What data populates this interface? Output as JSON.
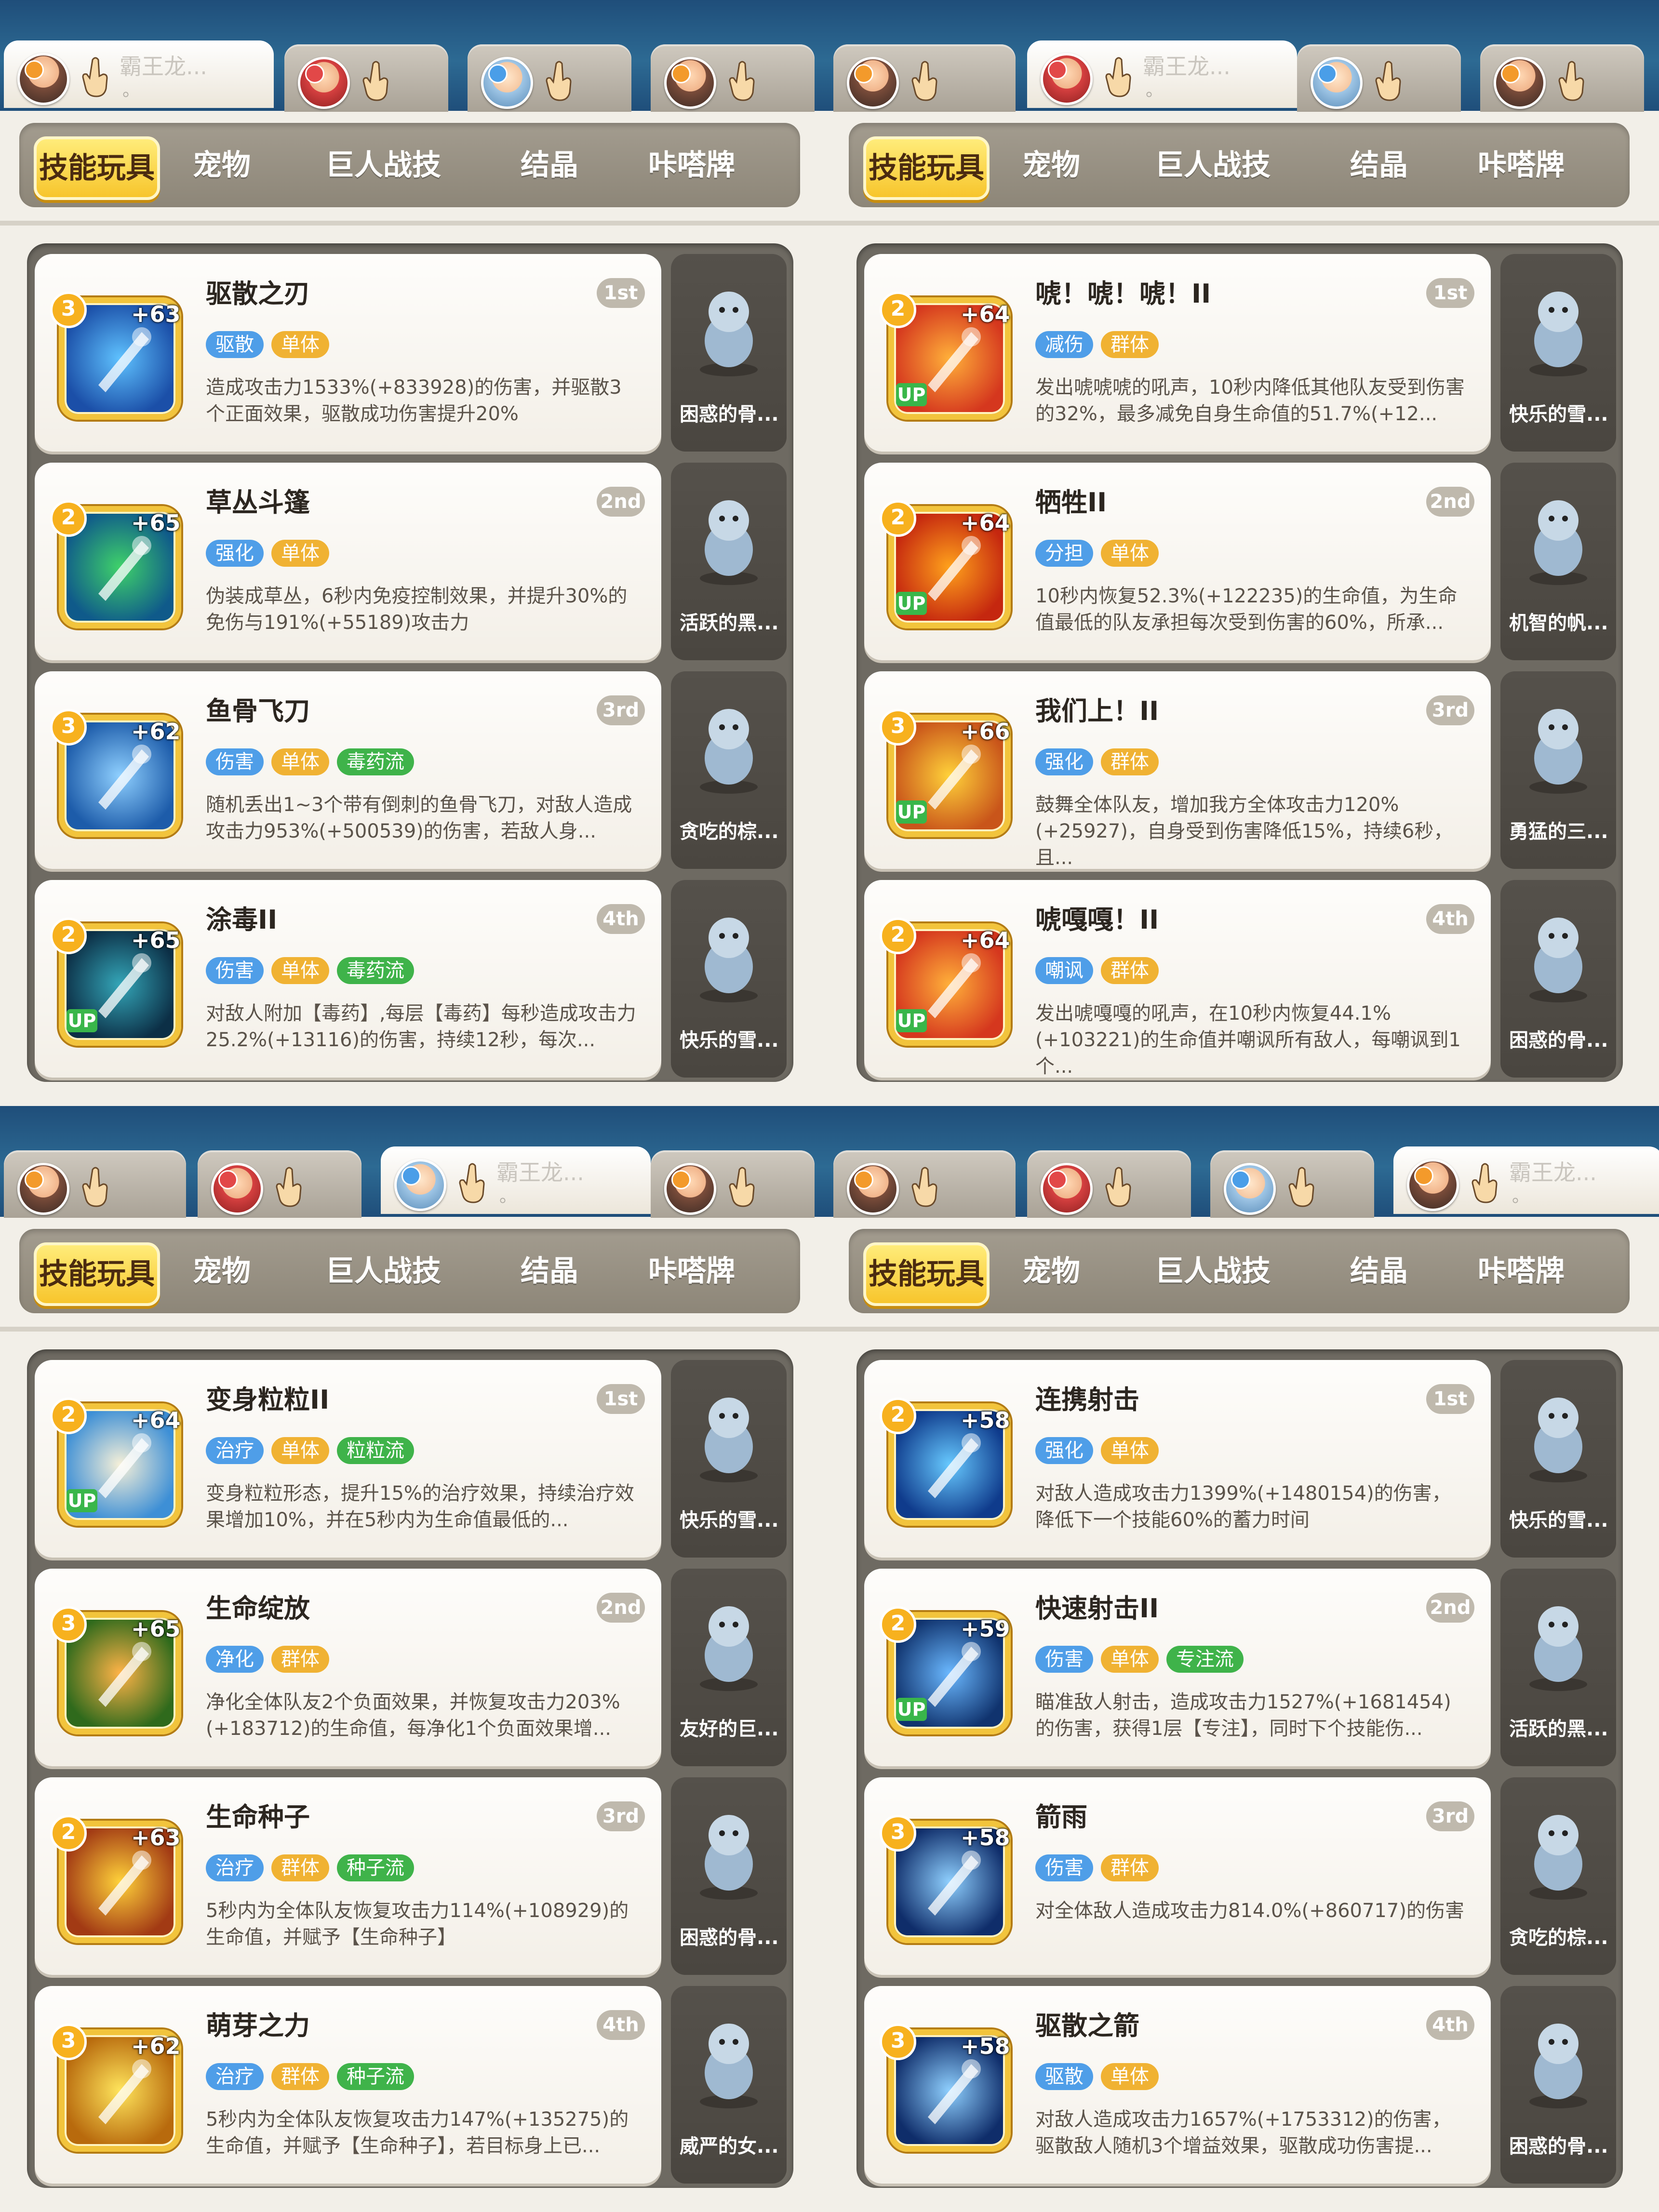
{
  "common": {
    "char_tab_name": "霸王龙...",
    "char_tab_dot": "。",
    "categories": [
      "技能玩具",
      "宠物",
      "巨人战技",
      "结晶",
      "咔嗒牌"
    ]
  },
  "panels": [
    {
      "active_tab": 0,
      "skills": [
        {
          "name": "驱散之刃",
          "rank": "1st",
          "tier": "3",
          "plus": "+63",
          "up": false,
          "tags": [
            "驱散",
            "单体"
          ],
          "desc": "造成攻击力1533%(+833928)的伤害，并驱散3个正面效果，驱散成功伤害提升20%",
          "pet": "困惑的骨...",
          "icon": "blade-icon"
        },
        {
          "name": "草丛斗篷",
          "rank": "2nd",
          "tier": "2",
          "plus": "+65",
          "up": false,
          "tags": [
            "强化",
            "单体"
          ],
          "desc": "伪装成草丛，6秒内免疫控制效果，并提升30%的免伤与191%(+55189)攻击力",
          "pet": "活跃的黑...",
          "icon": "bush-icon"
        },
        {
          "name": "鱼骨飞刀",
          "rank": "3rd",
          "tier": "3",
          "plus": "+62",
          "up": false,
          "tags": [
            "伤害",
            "单体",
            "毒药流"
          ],
          "desc": "随机丢出1~3个带有倒刺的鱼骨飞刀，对敌人造成攻击力953%(+500539)的伤害，若敌人身...",
          "pet": "贪吃的棕...",
          "icon": "fishbone-icon"
        },
        {
          "name": "涂毒II",
          "rank": "4th",
          "tier": "2",
          "plus": "+65",
          "up": true,
          "tags": [
            "伤害",
            "单体",
            "毒药流"
          ],
          "desc": "对敌人附加【毒药】,每层【毒药】每秒造成攻击力25.2%(+13116)的伤害，持续12秒，每次...",
          "pet": "快乐的雪...",
          "icon": "poison-drop-icon"
        }
      ]
    },
    {
      "active_tab": 1,
      "skills": [
        {
          "name": "唬！唬！唬！II",
          "rank": "1st",
          "tier": "2",
          "plus": "+64",
          "up": true,
          "tags": [
            "减伤",
            "群体"
          ],
          "desc": "发出唬唬唬的吼声，10秒内降低其他队友受到伤害的32%，最多减免自身生命值的51.7%(+12...",
          "pet": "快乐的雪...",
          "icon": "shout-icon"
        },
        {
          "name": "牺牲II",
          "rank": "2nd",
          "tier": "2",
          "plus": "+64",
          "up": true,
          "tags": [
            "分担",
            "单体"
          ],
          "desc": "10秒内恢复52.3%(+122235)的生命值，为生命值最低的队友承担每次受到伤害的60%，所承...",
          "pet": "机智的帆...",
          "icon": "sacrifice-icon"
        },
        {
          "name": "我们上！II",
          "rank": "3rd",
          "tier": "3",
          "plus": "+66",
          "up": true,
          "tags": [
            "强化",
            "群体"
          ],
          "desc": "鼓舞全体队友，增加我方全体攻击力120%(+25927)，自身受到伤害降低15%，持续6秒，且...",
          "pet": "勇猛的三...",
          "icon": "charge-icon"
        },
        {
          "name": "唬嘎嘎！II",
          "rank": "4th",
          "tier": "2",
          "plus": "+64",
          "up": true,
          "tags": [
            "嘲讽",
            "群体"
          ],
          "desc": "发出唬嘎嘎的吼声，在10秒内恢复44.1%(+103221)的生命值并嘲讽所有敌人，每嘲讽到1个...",
          "pet": "困惑的骨...",
          "icon": "taunt-icon"
        }
      ]
    },
    {
      "active_tab": 2,
      "skills": [
        {
          "name": "变身粒粒II",
          "rank": "1st",
          "tier": "2",
          "plus": "+64",
          "up": true,
          "tags": [
            "治疗",
            "单体",
            "粒粒流"
          ],
          "desc": "变身粒粒形态，提升15%的治疗效果，持续治疗效果增加10%，并在5秒内为生命值最低的...",
          "pet": "快乐的雪...",
          "icon": "owl-icon"
        },
        {
          "name": "生命绽放",
          "rank": "2nd",
          "tier": "3",
          "plus": "+65",
          "up": false,
          "tags": [
            "净化",
            "群体"
          ],
          "desc": "净化全体队友2个负面效果，并恢复攻击力203%(+183712)的生命值，每净化1个负面效果增...",
          "pet": "友好的巨...",
          "icon": "bloom-icon"
        },
        {
          "name": "生命种子",
          "rank": "3rd",
          "tier": "2",
          "plus": "+63",
          "up": false,
          "tags": [
            "治疗",
            "群体",
            "种子流"
          ],
          "desc": "5秒内为全体队友恢复攻击力114%(+108929)的生命值，并赋予【生命种子】",
          "pet": "困惑的骨...",
          "icon": "seed-icon"
        },
        {
          "name": "萌芽之力",
          "rank": "4th",
          "tier": "3",
          "plus": "+62",
          "up": false,
          "tags": [
            "治疗",
            "群体",
            "种子流"
          ],
          "desc": "5秒内为全体队友恢复攻击力147%(+135275)的生命值，并赋予【生命种子】，若目标身上已...",
          "pet": "威严的女...",
          "icon": "sprout-icon"
        }
      ]
    },
    {
      "active_tab": 3,
      "skills": [
        {
          "name": "连携射击",
          "rank": "1st",
          "tier": "2",
          "plus": "+58",
          "up": false,
          "tags": [
            "强化",
            "单体"
          ],
          "desc": "对敌人造成攻击力1399%(+1480154)的伤害，降低下一个技能60%的蓄力时间",
          "pet": "快乐的雪...",
          "icon": "ice-shot-icon"
        },
        {
          "name": "快速射击II",
          "rank": "2nd",
          "tier": "2",
          "plus": "+59",
          "up": true,
          "tags": [
            "伤害",
            "单体",
            "专注流"
          ],
          "desc": "瞄准敌人射击，造成攻击力1527%(+1681454)的伤害，获得1层【专注】，同时下个技能伤...",
          "pet": "活跃的黑...",
          "icon": "arrow-icon"
        },
        {
          "name": "箭雨",
          "rank": "3rd",
          "tier": "3",
          "plus": "+58",
          "up": false,
          "tags": [
            "伤害",
            "群体"
          ],
          "desc": "对全体敌人造成攻击力814.0%(+860717)的伤害",
          "pet": "贪吃的棕...",
          "icon": "arrow-rain-icon"
        },
        {
          "name": "驱散之箭",
          "rank": "4th",
          "tier": "3",
          "plus": "+58",
          "up": false,
          "tags": [
            "驱散",
            "单体"
          ],
          "desc": "对敌人造成攻击力1657%(+1753312)的伤害，驱散敌人随机3个增益效果，驱散成功伤害提...",
          "pet": "困惑的骨...",
          "icon": "dispel-arrow-icon"
        }
      ]
    }
  ],
  "tag_colors": {
    "blue": "#4f9ee8",
    "orange": "#f0b233",
    "green": "#3fb34a"
  }
}
